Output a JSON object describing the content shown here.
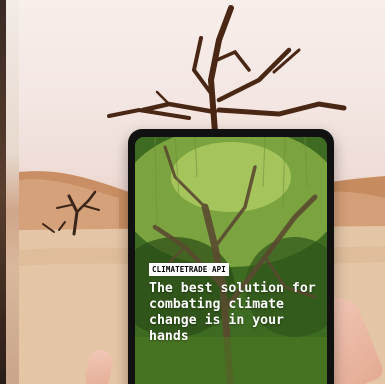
{
  "promo": {
    "tag": "CLIMATETRADE API",
    "headline": "The best solution for combating climate change is in your hands"
  },
  "colors": {
    "sky": "#f4e7e3",
    "dune": "#d7a67f",
    "sand": "#e3c7a9",
    "tablet_frame": "#111111",
    "headline_text": "#ffffff",
    "tag_background": "#ffffff"
  }
}
